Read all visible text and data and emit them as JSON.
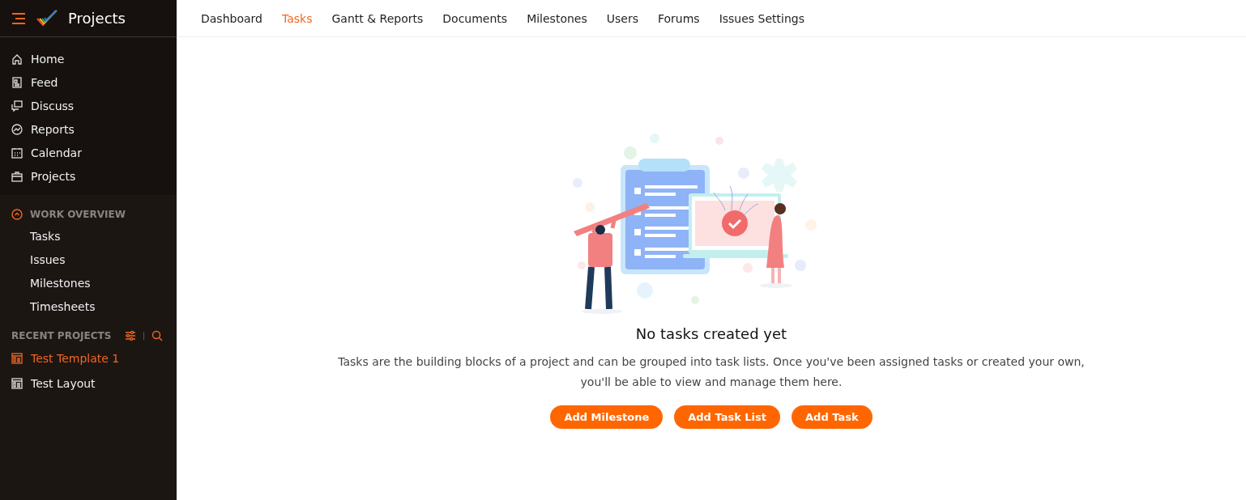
{
  "sidebar": {
    "app_title": "Projects",
    "nav_items": [
      {
        "label": "Home"
      },
      {
        "label": "Feed"
      },
      {
        "label": "Discuss"
      },
      {
        "label": "Reports"
      },
      {
        "label": "Calendar"
      },
      {
        "label": "Projects"
      }
    ],
    "work_overview": {
      "title": "WORK OVERVIEW",
      "expanded": true,
      "items": [
        {
          "label": "Tasks"
        },
        {
          "label": "Issues"
        },
        {
          "label": "Milestones"
        },
        {
          "label": "Timesheets"
        }
      ]
    },
    "recent_projects": {
      "title": "RECENT PROJECTS",
      "items": [
        {
          "label": "Test Template 1",
          "selected": true
        },
        {
          "label": "Test Layout",
          "selected": false
        }
      ]
    }
  },
  "tabs": [
    {
      "label": "Dashboard",
      "selected": false
    },
    {
      "label": "Tasks",
      "selected": true
    },
    {
      "label": "Gantt & Reports",
      "selected": false
    },
    {
      "label": "Documents",
      "selected": false
    },
    {
      "label": "Milestones",
      "selected": false
    },
    {
      "label": "Users",
      "selected": false
    },
    {
      "label": "Forums",
      "selected": false
    },
    {
      "label": "Issues Settings",
      "selected": false
    }
  ],
  "empty_state": {
    "title": "No tasks created yet",
    "message": "Tasks are the building blocks of a project and can be grouped into task lists. Once you've been assigned tasks or created your own, you'll be able to view and manage them here.",
    "buttons": [
      "Add Milestone",
      "Add Task List",
      "Add Task"
    ]
  }
}
